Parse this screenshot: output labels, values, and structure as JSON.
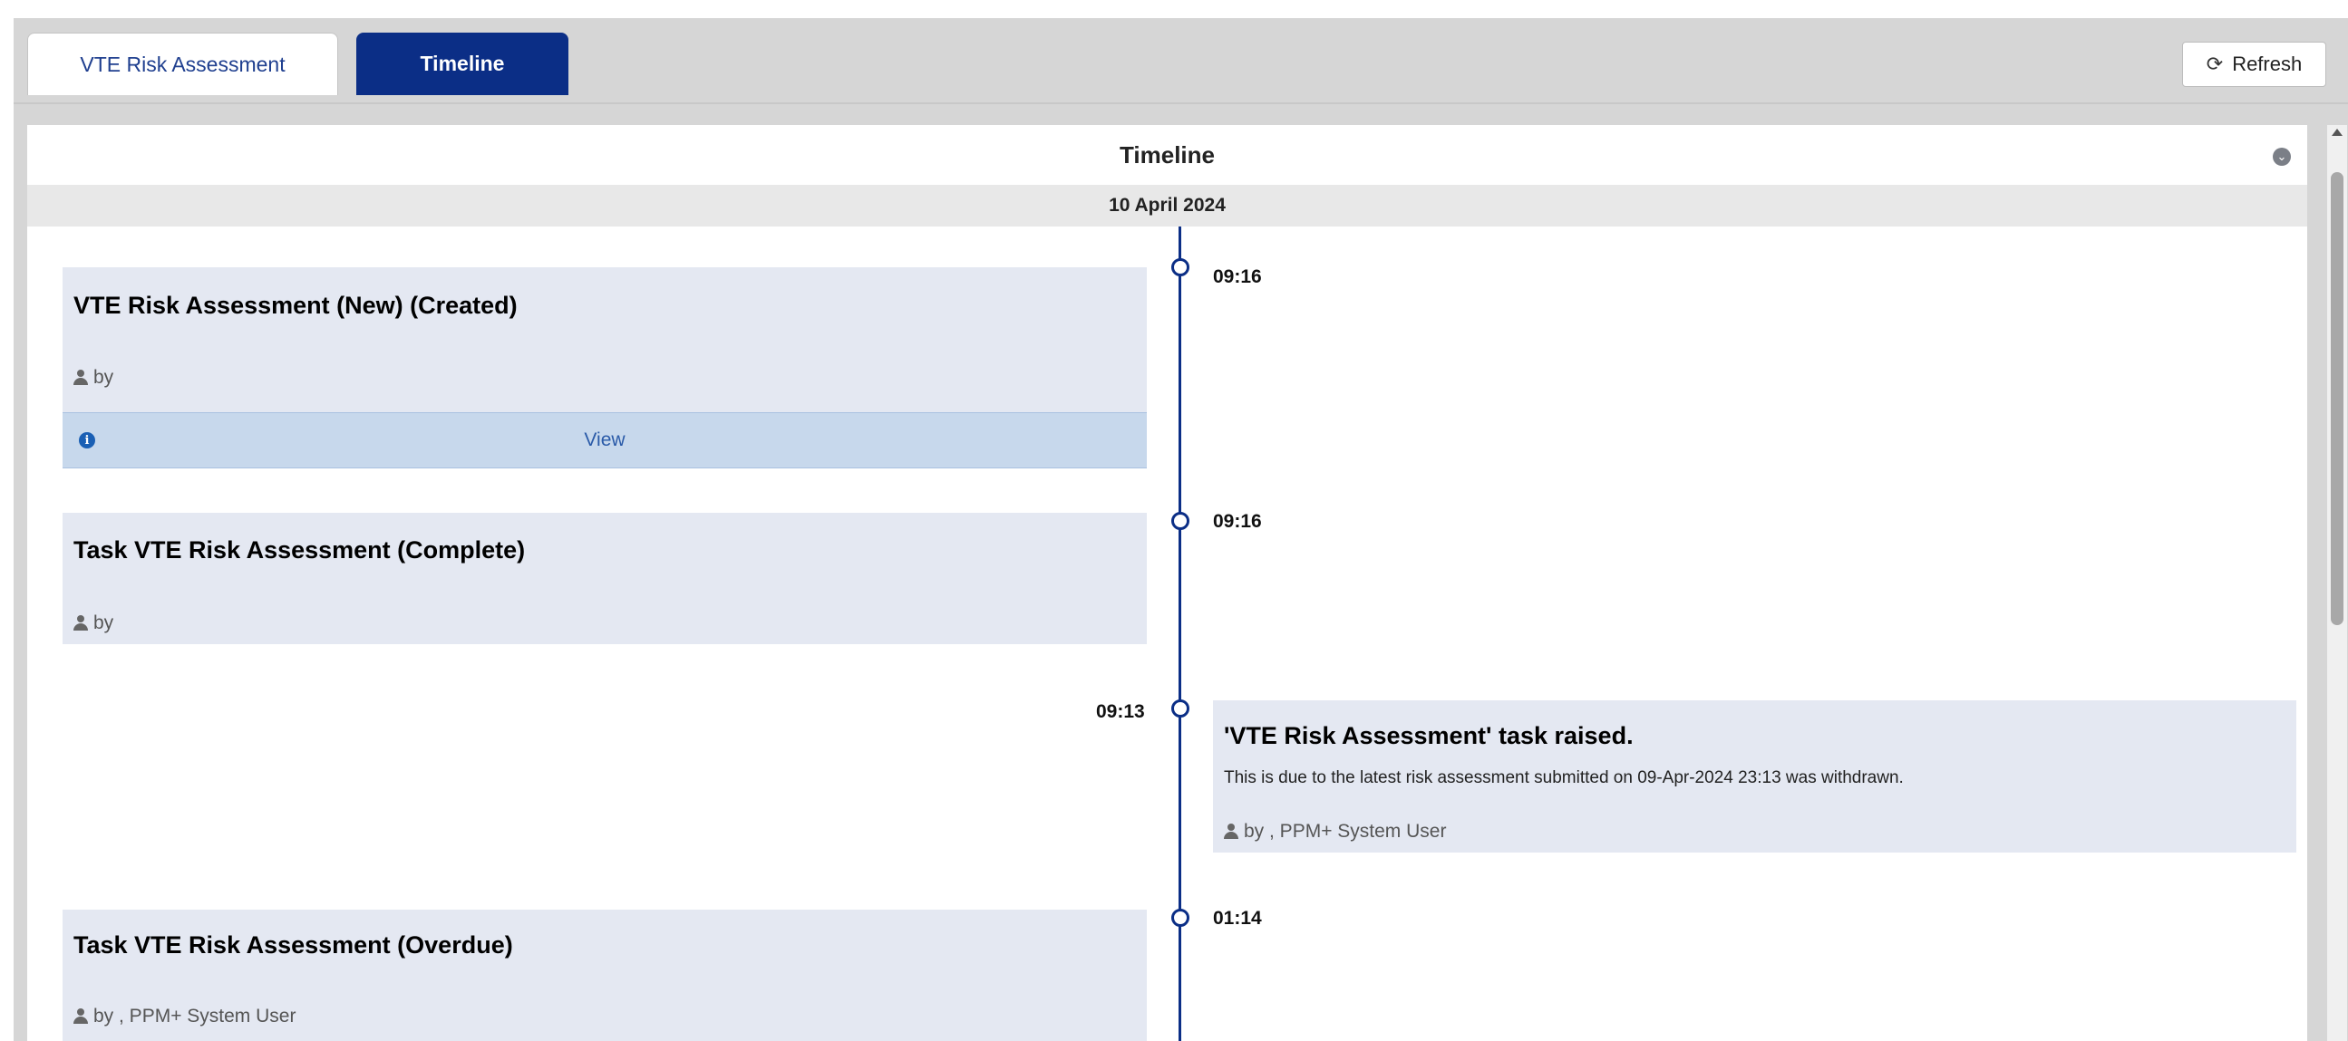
{
  "tabs": [
    {
      "label": "VTE Risk Assessment",
      "active": false
    },
    {
      "label": "Timeline",
      "active": true
    }
  ],
  "toolbar": {
    "refresh_label": "Refresh",
    "refresh_icon": "refresh-icon"
  },
  "panel": {
    "title": "Timeline",
    "collapse_icon": "chevron-down-icon"
  },
  "date_header": "10 April 2024",
  "events": [
    {
      "time": "09:16",
      "title": "VTE Risk Assessment (New) (Created)",
      "by": "by",
      "action_label": "View",
      "side": "left"
    },
    {
      "time": "09:16",
      "title": "Task VTE Risk Assessment (Complete)",
      "by": "by",
      "side": "left"
    },
    {
      "time": "09:13",
      "title": "'VTE Risk Assessment' task raised.",
      "description": "This is due to the latest risk assessment submitted on 09-Apr-2024 23:13 was withdrawn.",
      "by": "by , PPM+ System User",
      "side": "right"
    },
    {
      "time": "01:14",
      "title": "Task VTE Risk Assessment (Overdue)",
      "by": "by , PPM+ System User",
      "side": "left"
    }
  ],
  "colors": {
    "accent": "#0b2e86",
    "card_bg": "#e4e8f2",
    "view_bar_bg": "#c7d8ec"
  }
}
